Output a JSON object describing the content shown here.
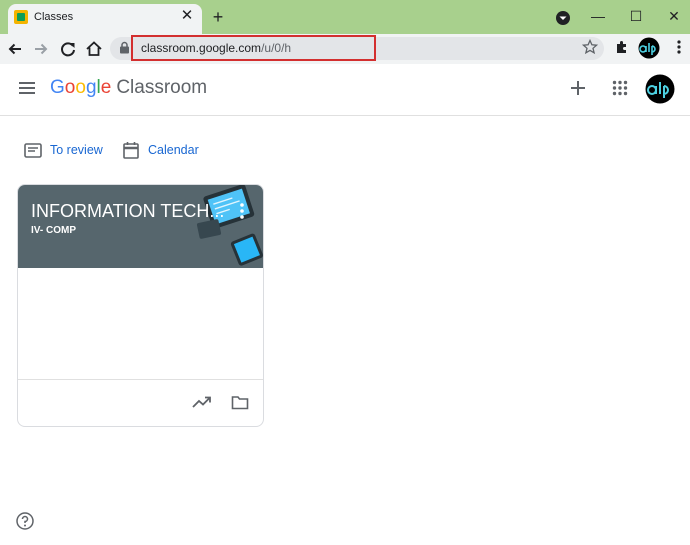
{
  "browser": {
    "tab_title": "Classes",
    "tab_close": "✕",
    "new_tab": "+",
    "window_controls": {
      "minimize": "—",
      "maximize": "☐",
      "close": "✕"
    },
    "url_host": "classroom.google.com",
    "url_path": "/u/0/h"
  },
  "header": {
    "logo_letters": [
      "G",
      "o",
      "o",
      "g",
      "l",
      "e"
    ],
    "product": "Classroom"
  },
  "nav": {
    "to_review": "To review",
    "calendar": "Calendar"
  },
  "card": {
    "title": "INFORMATION TECH...",
    "section": "IV- COMP"
  },
  "colors": {
    "accent": "#1967d2",
    "titlebar": "#a8d08d",
    "card_banner": "#56666d",
    "highlight": "#d32f2f"
  }
}
